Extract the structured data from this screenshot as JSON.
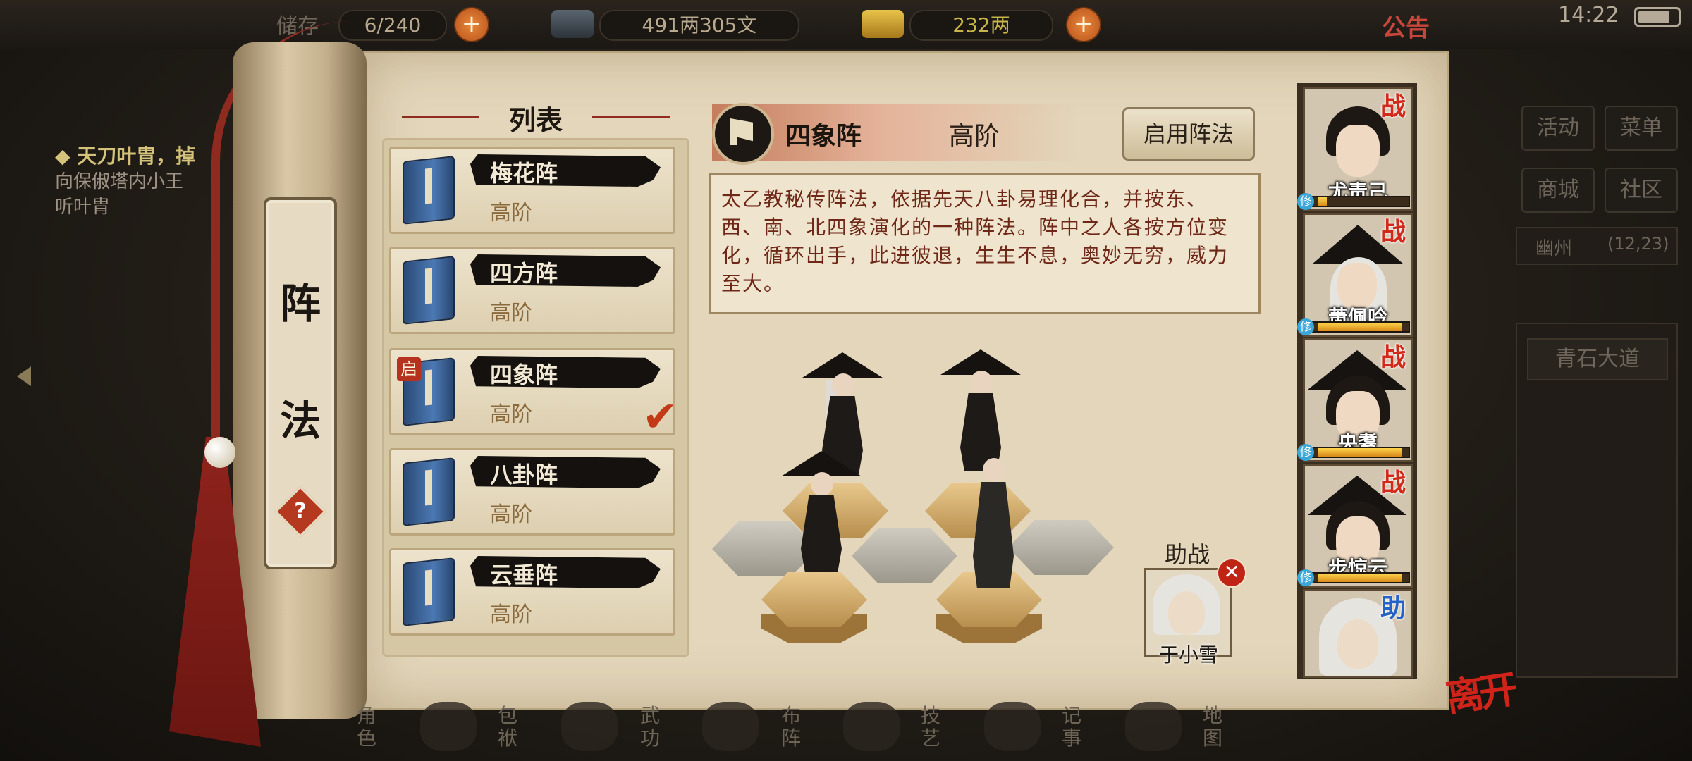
{
  "top_bar": {
    "bag_label": "储存",
    "bag_count": "6/240",
    "money": "491两305文",
    "gold": "232两",
    "notice": "公告",
    "time": "14:22"
  },
  "quest": {
    "title": "◆ 天刀叶胄，掉",
    "desc_line1": "向保俶塔内小王",
    "desc_line2": "听叶胄"
  },
  "right_panel": {
    "activity": "活动",
    "menu": "菜单",
    "shop": "商城",
    "community": "社区",
    "location": "幽州",
    "coords": "(12,23)",
    "place": "青石大道"
  },
  "scroll": {
    "title_char1": "阵",
    "title_char2": "法",
    "help": "?"
  },
  "list": {
    "title": "列表",
    "items": [
      {
        "name": "梅花阵",
        "level": "高阶"
      },
      {
        "name": "四方阵",
        "level": "高阶"
      },
      {
        "name": "四象阵",
        "level": "高阶",
        "badge": "启",
        "selected": true
      },
      {
        "name": "八卦阵",
        "level": "高阶"
      },
      {
        "name": "云垂阵",
        "level": "高阶"
      }
    ]
  },
  "detail": {
    "name": "四象阵",
    "level": "高阶",
    "enable_button": "启用阵法",
    "description": "太乙教秘传阵法，依据先天八卦易理化合，并按东、西、南、北四象演化的一种阵法。阵中之人各按方位变化，循环出手，此进彼退，生生不息，奥妙无穷，威力至大。"
  },
  "assist": {
    "label": "助战",
    "name": "于小雪"
  },
  "members": [
    {
      "name": "尤责己",
      "badge": "战",
      "xp": 0.15,
      "tag": "修"
    },
    {
      "name": "萧佩吟",
      "badge": "战",
      "xp": 0.9,
      "tag": "修"
    },
    {
      "name": "央耋",
      "badge": "战",
      "xp": 0.9,
      "tag": "修"
    },
    {
      "name": "步惊云",
      "badge": "战",
      "xp": 0.9,
      "tag": "修"
    },
    {
      "name": "",
      "badge": "助"
    }
  ],
  "bottom_menu": {
    "role": "角色",
    "bag": "包袱",
    "martial": "武功",
    "formation": "布阵",
    "skills": "技艺",
    "journal": "记事",
    "map": "地图"
  },
  "leave": "离开",
  "colors": {
    "accent_red": "#c7463b",
    "parchment": "#e3d6ba",
    "desc_text": "#6f2818"
  }
}
